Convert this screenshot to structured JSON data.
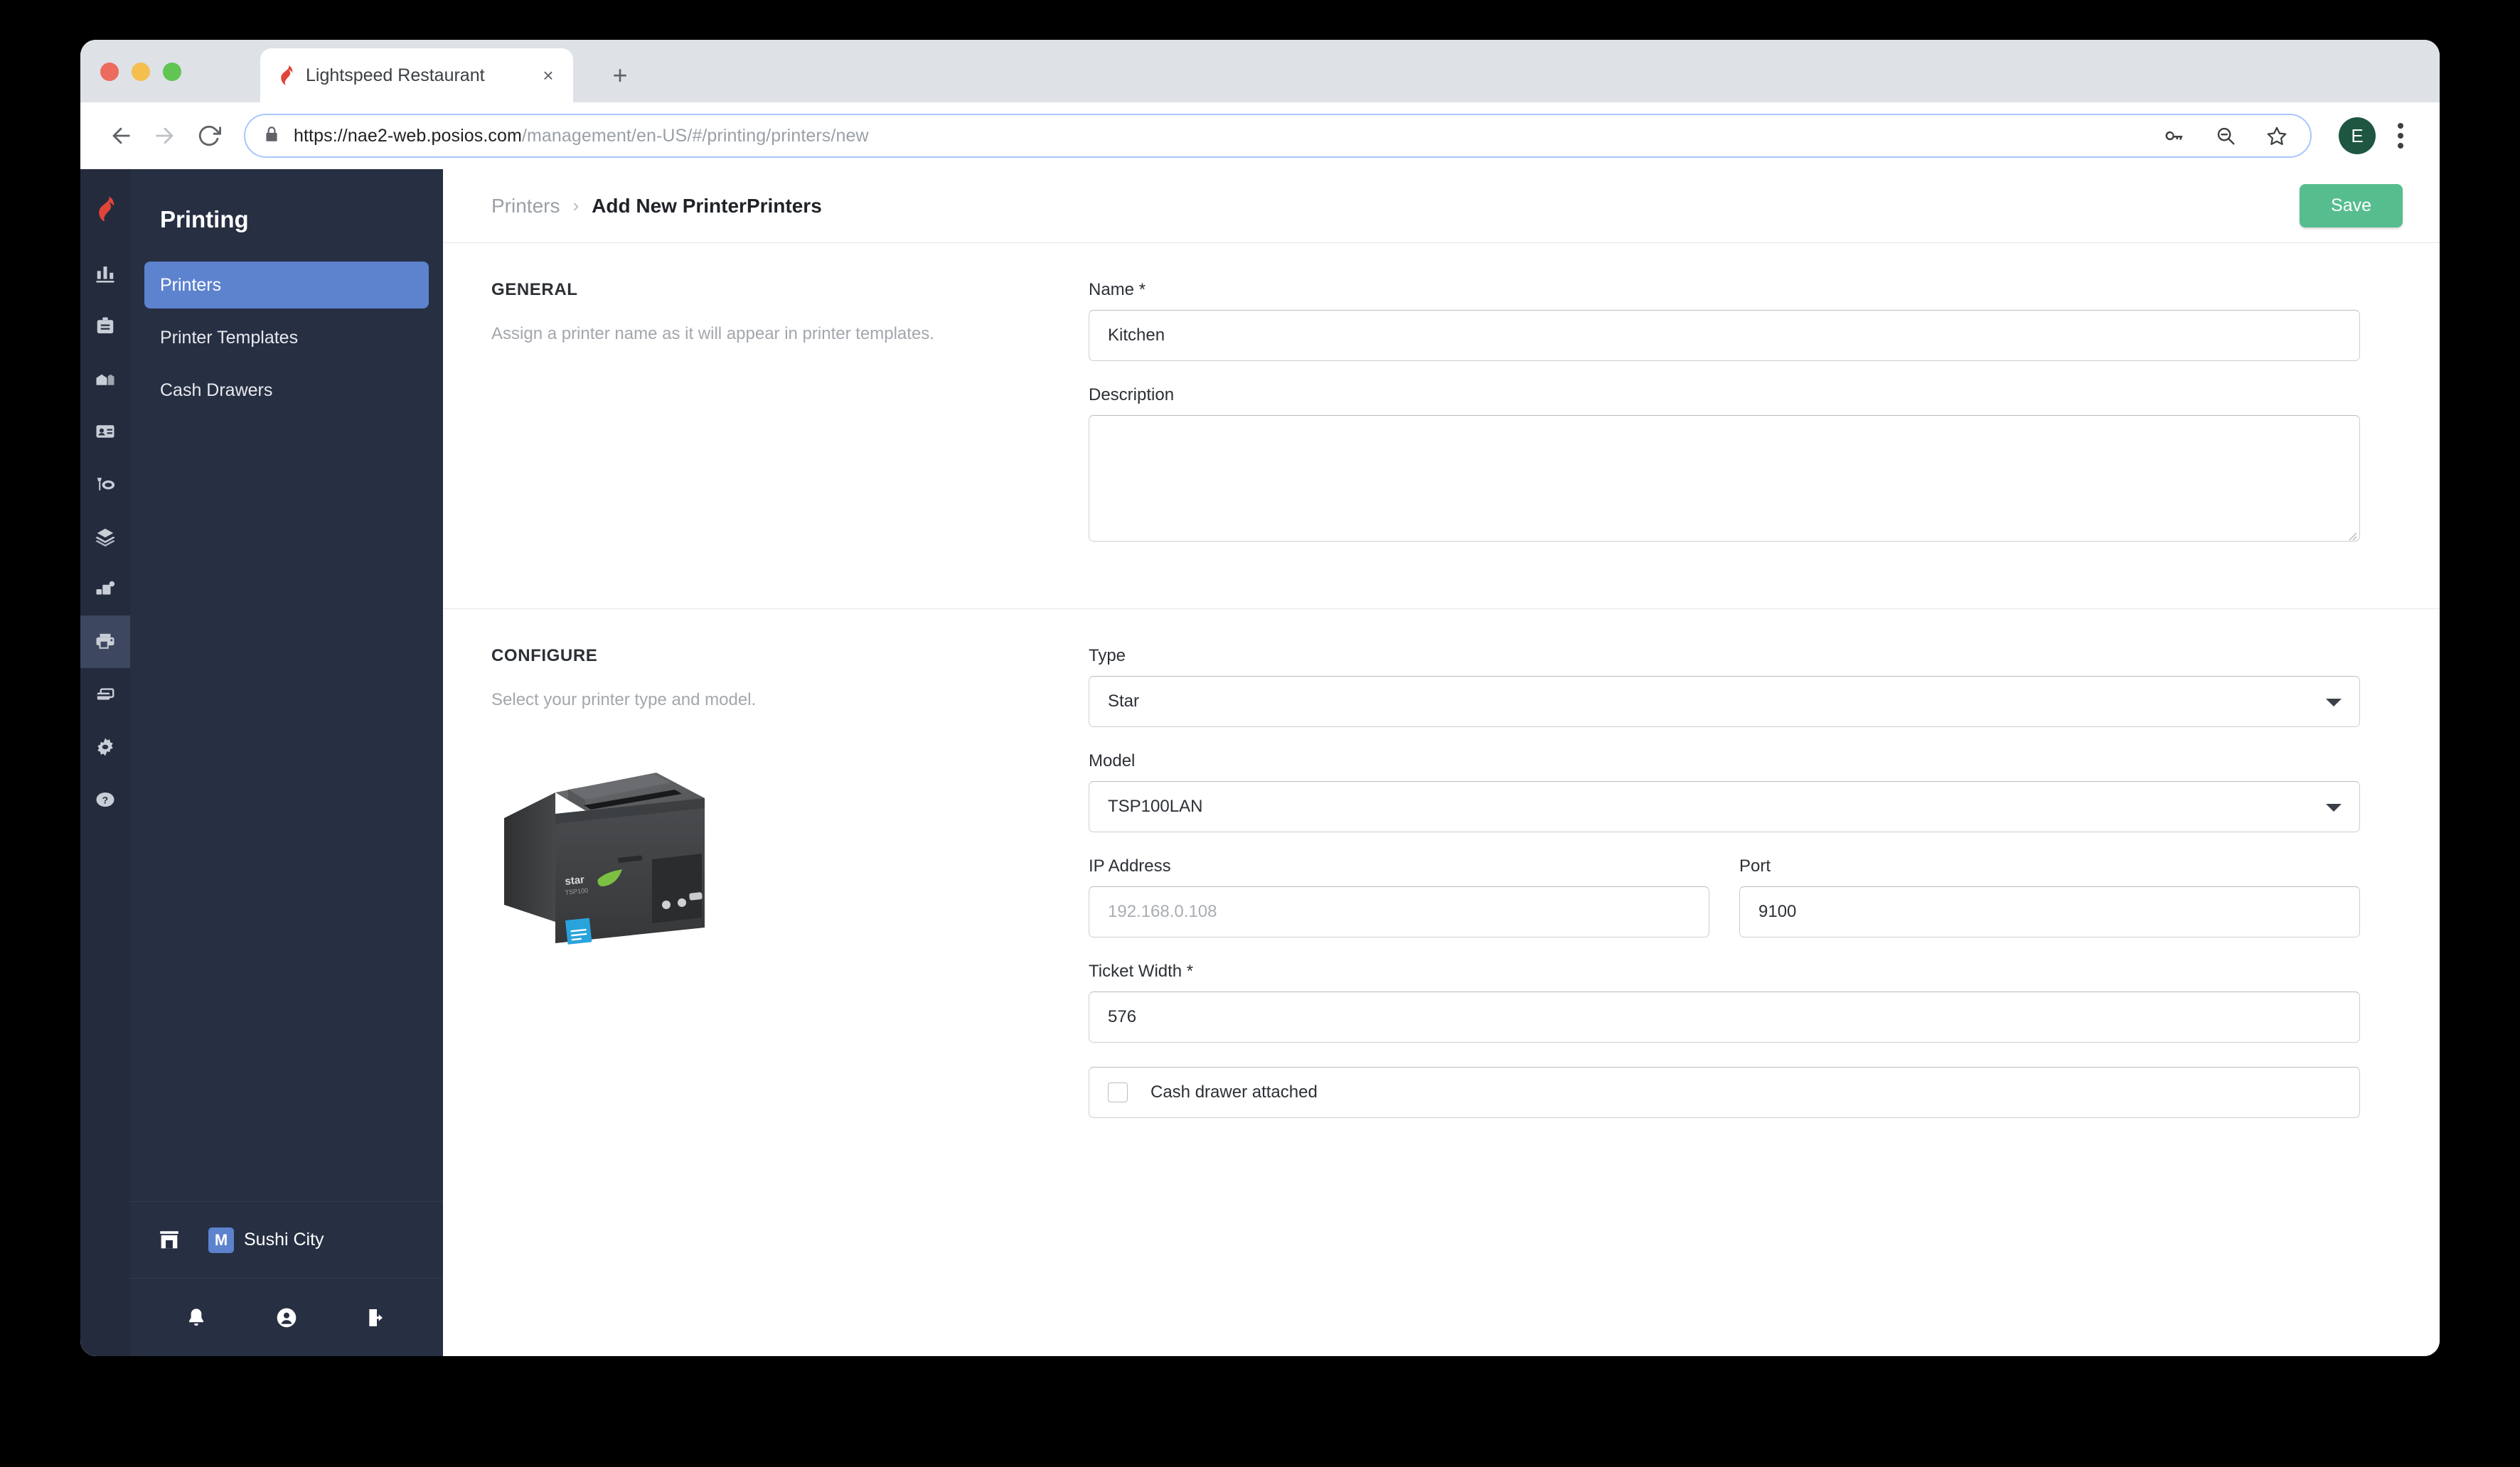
{
  "browser": {
    "tab": {
      "title": "Lightspeed Restaurant",
      "favicon": "lightspeed-flame-icon",
      "close": "×"
    },
    "new_tab_label": "+",
    "nav": {
      "back": "back-icon",
      "forward": "forward-icon",
      "reload": "reload-icon"
    },
    "omnibox": {
      "lock": "lock-icon",
      "url_host": "https://nae2-web.posios.com",
      "url_path": "/management/en-US/#/printing/printers/new",
      "key_icon": "key-icon",
      "zoom_icon": "zoom-out-icon",
      "bookmark_icon": "star-icon"
    },
    "profile_initial": "E",
    "menu_icon": "kebab-menu-icon"
  },
  "rail": {
    "logo": "lightspeed-logo",
    "items": [
      {
        "name": "reports-icon",
        "active": false
      },
      {
        "name": "clipboard-icon",
        "active": false
      },
      {
        "name": "company-icon",
        "active": false
      },
      {
        "name": "id-card-icon",
        "active": false
      },
      {
        "name": "dining-icon",
        "active": false
      },
      {
        "name": "layers-icon",
        "active": false
      },
      {
        "name": "devices-icon",
        "active": false
      },
      {
        "name": "printer-icon",
        "active": true
      },
      {
        "name": "cards-icon",
        "active": false
      },
      {
        "name": "gear-icon",
        "active": false
      },
      {
        "name": "help-icon",
        "active": false
      }
    ]
  },
  "sidebar": {
    "title": "Printing",
    "items": [
      {
        "label": "Printers",
        "active": true
      },
      {
        "label": "Printer Templates",
        "active": false
      },
      {
        "label": "Cash Drawers",
        "active": false
      }
    ],
    "store": {
      "icon": "store-icon",
      "badge": "M",
      "name": "Sushi City"
    },
    "footer": [
      {
        "name": "bell-icon"
      },
      {
        "name": "account-icon"
      },
      {
        "name": "logout-icon"
      }
    ]
  },
  "header": {
    "breadcrumb_parent": "Printers",
    "breadcrumb_separator": "›",
    "breadcrumb_current": "Add New PrinterPrinters",
    "save_label": "Save"
  },
  "general": {
    "title": "GENERAL",
    "description": "Assign a printer name as it will appear in printer templates.",
    "name_label": "Name *",
    "name_value": "Kitchen",
    "desc_label": "Description",
    "desc_value": ""
  },
  "configure": {
    "title": "CONFIGURE",
    "description": "Select your printer type and model.",
    "printer_image": "star-tsp100-printer",
    "type_label": "Type",
    "type_value": "Star",
    "model_label": "Model",
    "model_value": "TSP100LAN",
    "ip_label": "IP Address",
    "ip_placeholder": "192.168.0.108",
    "port_label": "Port",
    "port_value": "9100",
    "ticket_label": "Ticket Width *",
    "ticket_value": "576",
    "cash_drawer_label": "Cash drawer attached",
    "cash_drawer_checked": false
  },
  "colors": {
    "accent_blue": "#5d82ce",
    "save_green": "#56bd8f",
    "rail_dark": "#242b3d",
    "panel_dark": "#272f42",
    "brand_red": "#e0453a"
  }
}
